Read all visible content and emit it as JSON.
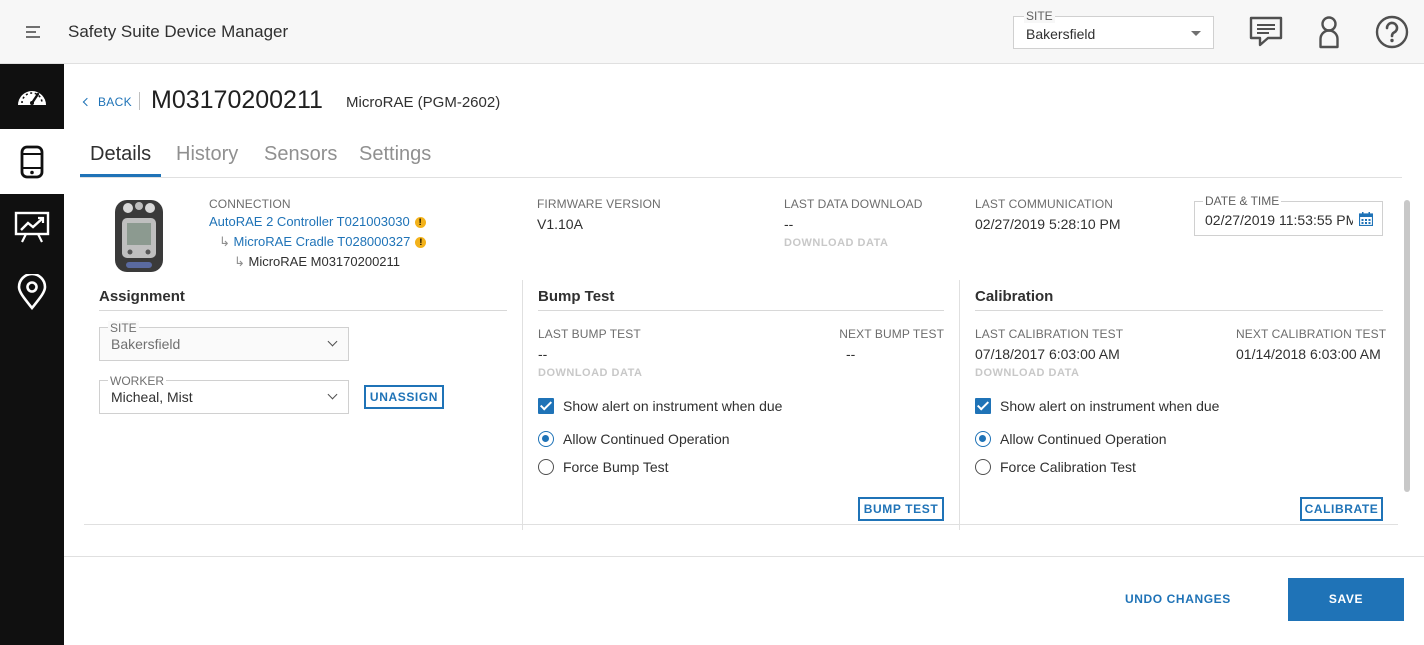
{
  "app": {
    "title": "Safety Suite Device Manager"
  },
  "header": {
    "site_label": "SITE",
    "site_value": "Bakersfield",
    "icons": [
      "chat-icon",
      "user-icon",
      "help-icon"
    ]
  },
  "sidebar": {
    "items": [
      {
        "name": "dashboard",
        "icon": "speedometer-icon",
        "active": false
      },
      {
        "name": "devices",
        "icon": "device-icon",
        "active": true
      },
      {
        "name": "reports",
        "icon": "presentation-chart-icon",
        "active": false
      },
      {
        "name": "locations",
        "icon": "map-pin-icon",
        "active": false
      }
    ]
  },
  "page": {
    "back_label": "BACK",
    "serial": "M03170200211",
    "model": "MicroRAE (PGM-2602)"
  },
  "tabs": [
    {
      "label": "Details",
      "active": true
    },
    {
      "label": "History",
      "active": false
    },
    {
      "label": "Sensors",
      "active": false
    },
    {
      "label": "Settings",
      "active": false
    }
  ],
  "connection": {
    "label": "CONNECTION",
    "controller": "AutoRAE 2 Controller T021003030",
    "cradle": "MicroRAE Cradle T028000327",
    "device": "MicroRAE M03170200211"
  },
  "firmware": {
    "label": "FIRMWARE VERSION",
    "value": "V1.10A"
  },
  "last_download": {
    "label": "LAST DATA DOWNLOAD",
    "value": "--",
    "action": "DOWNLOAD DATA"
  },
  "last_comm": {
    "label": "LAST COMMUNICATION",
    "value": "02/27/2019 5:28:10 PM"
  },
  "datetime": {
    "label": "DATE & TIME",
    "value": "02/27/2019 11:53:55 PM"
  },
  "assignment": {
    "title": "Assignment",
    "site_label": "SITE",
    "site_value": "Bakersfield",
    "worker_label": "WORKER",
    "worker_value": "Micheal, Mist",
    "unassign": "UNASSIGN"
  },
  "bump": {
    "title": "Bump Test",
    "last_label": "LAST BUMP TEST",
    "last_value": "--",
    "next_label": "NEXT BUMP TEST",
    "next_value": "--",
    "download": "DOWNLOAD DATA",
    "alert": "Show alert on instrument when due",
    "opt1": "Allow Continued Operation",
    "opt2": "Force Bump Test",
    "button": "BUMP TEST"
  },
  "calibration": {
    "title": "Calibration",
    "last_label": "LAST CALIBRATION TEST",
    "last_value": "07/18/2017 6:03:00 AM",
    "next_label": "NEXT CALIBRATION TEST",
    "next_value": "01/14/2018 6:03:00 AM",
    "download": "DOWNLOAD DATA",
    "alert": "Show alert on instrument when due",
    "opt1": "Allow Continued Operation",
    "opt2": "Force Calibration Test",
    "button": "CALIBRATE"
  },
  "footer": {
    "undo": "UNDO CHANGES",
    "save": "SAVE"
  },
  "colors": {
    "accent": "#1f73b7",
    "sidebar": "#101010",
    "warning": "#f3b21a"
  }
}
